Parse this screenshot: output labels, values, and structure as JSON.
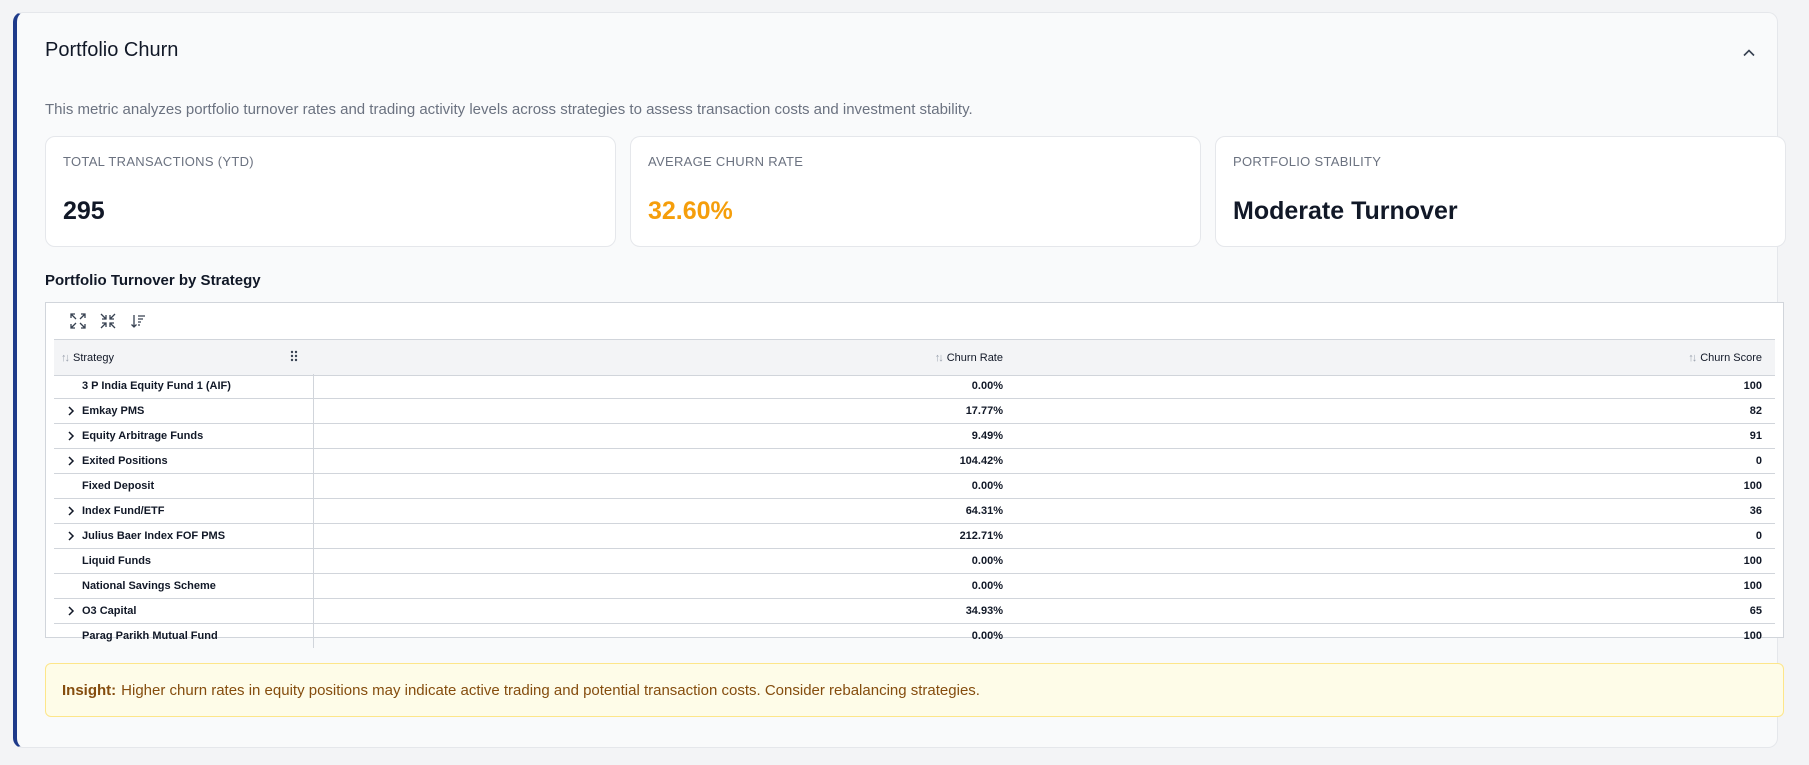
{
  "header": {
    "title": "Portfolio Churn",
    "description": "This metric analyzes portfolio turnover rates and trading activity levels across strategies to assess transaction costs and investment stability."
  },
  "stats": [
    {
      "label": "TOTAL TRANSACTIONS (YTD)",
      "value": "295"
    },
    {
      "label": "AVERAGE CHURN RATE",
      "value": "32.60%",
      "color": "#f59e0b"
    },
    {
      "label": "PORTFOLIO STABILITY",
      "value": "Moderate Turnover"
    }
  ],
  "section": {
    "title": "Portfolio Turnover by Strategy"
  },
  "grid": {
    "columns": {
      "strategy": "Strategy",
      "churn_rate": "Churn Rate",
      "churn_score": "Churn Score"
    },
    "toolbar_icons": [
      "expand-all-icon",
      "collapse-all-icon",
      "sort-icon"
    ],
    "rows": [
      {
        "name": "3 P India Equity Fund 1 (AIF)",
        "rate": "0.00%",
        "score": "100",
        "expandable": false
      },
      {
        "name": "Emkay PMS",
        "rate": "17.77%",
        "score": "82",
        "expandable": true
      },
      {
        "name": "Equity Arbitrage Funds",
        "rate": "9.49%",
        "score": "91",
        "expandable": true
      },
      {
        "name": "Exited Positions",
        "rate": "104.42%",
        "score": "0",
        "expandable": true
      },
      {
        "name": "Fixed Deposit",
        "rate": "0.00%",
        "score": "100",
        "expandable": false
      },
      {
        "name": "Index Fund/ETF",
        "rate": "64.31%",
        "score": "36",
        "expandable": true
      },
      {
        "name": "Julius Baer Index FOF PMS",
        "rate": "212.71%",
        "score": "0",
        "expandable": true
      },
      {
        "name": "Liquid Funds",
        "rate": "0.00%",
        "score": "100",
        "expandable": false
      },
      {
        "name": "National Savings Scheme",
        "rate": "0.00%",
        "score": "100",
        "expandable": false
      },
      {
        "name": "O3 Capital",
        "rate": "34.93%",
        "score": "65",
        "expandable": true
      },
      {
        "name": "Parag Parikh Mutual Fund",
        "rate": "0.00%",
        "score": "100",
        "expandable": false
      }
    ]
  },
  "insight": {
    "label": "Insight:",
    "text": "Higher churn rates in equity positions may indicate active trading and potential transaction costs. Consider rebalancing strategies."
  },
  "colors": {
    "accent": "#1e3a8a",
    "warning": "#f59e0b",
    "insight_text": "#854d0e"
  }
}
